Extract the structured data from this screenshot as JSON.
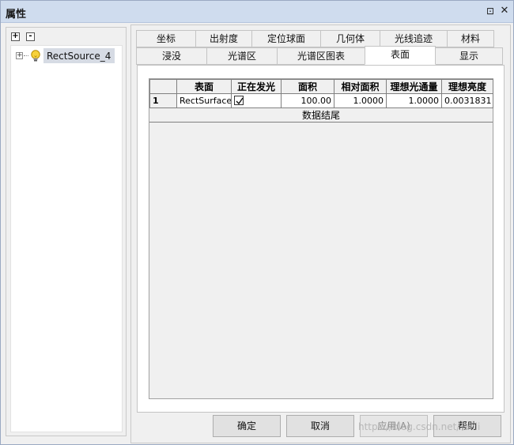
{
  "window": {
    "title": "属性",
    "pin_glyph": "⊡",
    "close_glyph": "✕"
  },
  "tree": {
    "expand_all_glyph": "+",
    "collapse_all_glyph": "-",
    "expander_glyph": "+",
    "node_icon": "lightbulb-icon",
    "node_label": "RectSource_4"
  },
  "tabs_row1": [
    "坐标",
    "出射度",
    "定位球面",
    "几何体",
    "光线追迹",
    "材料"
  ],
  "tabs_row2": [
    "浸没",
    "光谱区",
    "光谱区图表",
    "表面",
    "显示"
  ],
  "active_tab": "表面",
  "grid": {
    "columns": [
      "",
      "表面",
      "正在发光",
      "面积",
      "相对面积",
      "理想光通量",
      "理想亮度"
    ],
    "rows": [
      {
        "index": "1",
        "surface": "RectSurface",
        "emitting": true,
        "area": "100.00",
        "relative_area": "1.0000",
        "ideal_flux": "1.0000",
        "ideal_luminance": "0.0031831"
      }
    ],
    "data_end_label": "数据结尾"
  },
  "buttons": {
    "ok": "确定",
    "cancel": "取消",
    "apply": "应用(A)",
    "help": "帮助"
  },
  "watermark": "https://blog.csdn.net/Taiiii",
  "colors": {
    "titlebar": "#cfdcee",
    "selection": "#d6dbe4"
  }
}
